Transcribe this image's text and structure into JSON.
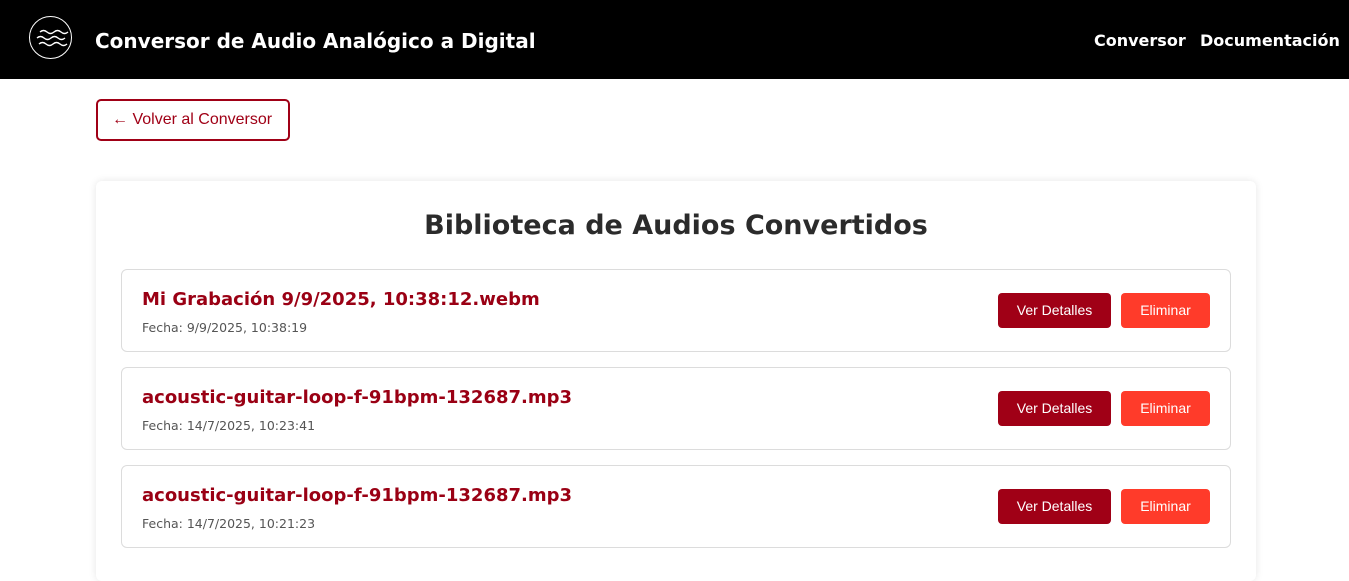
{
  "header": {
    "logo_icon": "waves-icon",
    "title": "Conversor de Audio Analógico a Digital",
    "nav": {
      "conversor": "Conversor",
      "documentacion": "Documentación"
    }
  },
  "back_button": {
    "label": "← Volver al Conversor"
  },
  "library": {
    "title": "Biblioteca de Audios Convertidos",
    "items": [
      {
        "name": "Mi Grabación 9/9/2025, 10:38:12.webm",
        "date": "Fecha: 9/9/2025, 10:38:19",
        "details_label": "Ver Detalles",
        "delete_label": "Eliminar"
      },
      {
        "name": "acoustic-guitar-loop-f-91bpm-132687.mp3",
        "date": "Fecha: 14/7/2025, 10:23:41",
        "details_label": "Ver Detalles",
        "delete_label": "Eliminar"
      },
      {
        "name": "acoustic-guitar-loop-f-91bpm-132687.mp3",
        "date": "Fecha: 14/7/2025, 10:21:23",
        "details_label": "Ver Detalles",
        "delete_label": "Eliminar"
      }
    ]
  },
  "colors": {
    "header_bg": "#000000",
    "accent": "#a00016",
    "delete": "#ff3b2a",
    "title_text": "#2b2b2b"
  }
}
